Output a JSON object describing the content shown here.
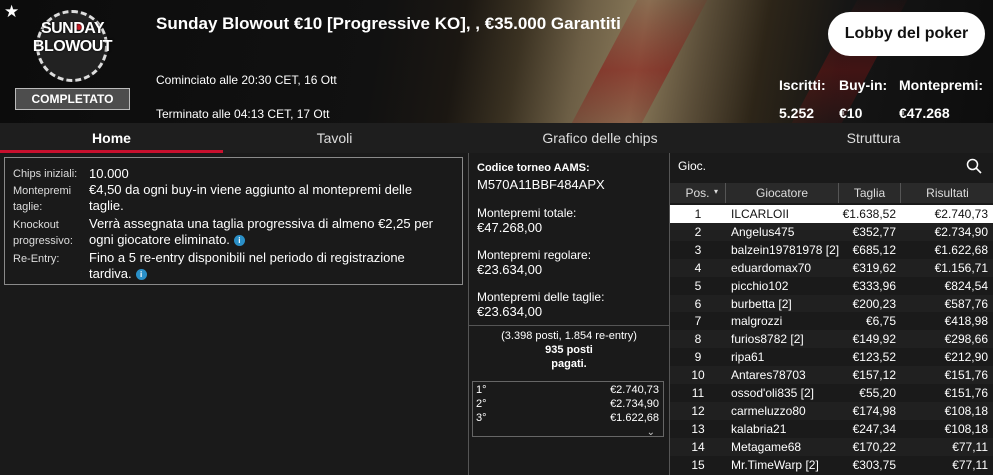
{
  "header": {
    "logo_line1": "SUNDAY",
    "logo_line2": "BLOWOUT",
    "status": "COMPLETATO",
    "title": "Sunday Blowout €10 [Progressive KO], , €35.000 Garantiti",
    "started": "Cominciato alle 20:30 CET, 16 Ott",
    "ended": "Terminato alle 04:13 CET, 17 Ott",
    "lobby_button": "Lobby del poker",
    "stats": [
      {
        "label": "Iscritti:",
        "value": "5.252"
      },
      {
        "label": "Buy-in:",
        "value": "€10"
      },
      {
        "label": "Montepremi:",
        "value": "€47.268"
      }
    ]
  },
  "tabs": [
    "Home",
    "Tavoli",
    "Grafico delle chips",
    "Struttura"
  ],
  "info": [
    {
      "label": "Chips iniziali:",
      "value": "10.000"
    },
    {
      "label": "Montepremi taglie:",
      "value": "€4,50 da ogni buy-in viene aggiunto al montepremi delle taglie."
    },
    {
      "label": "Knockout progressivo:",
      "value": "Verrà assegnata una taglia progressiva di almeno €2,25 per ogni giocatore eliminato."
    },
    {
      "label": "Re-Entry:",
      "value": "Fino a 5 re-entry disponibili nel periodo di registrazione tardiva."
    }
  ],
  "middle": {
    "aams_label": "Codice torneo AAMS:",
    "aams_value": "M570A11BBF484APX",
    "total_label": "Montepremi totale:",
    "total_value": "€47.268,00",
    "regular_label": "Montepremi regolare:",
    "regular_value": "€23.634,00",
    "bounty_label": "Montepremi delle taglie:",
    "bounty_value": "€23.634,00",
    "places_line1": "(3.398 posti, 1.854 re-entry)",
    "places_line2": "935 posti",
    "places_line3": "pagati.",
    "prizes": [
      {
        "place": "1°",
        "amount": "€2.740,73"
      },
      {
        "place": "2°",
        "amount": "€2.734,90"
      },
      {
        "place": "3°",
        "amount": "€1.622,68"
      }
    ]
  },
  "players": {
    "search_label": "Gioc.",
    "columns": [
      "Pos.",
      "Giocatore",
      "Taglia",
      "Risultati"
    ],
    "rows": [
      {
        "pos": "1",
        "name": "ILCARLOII",
        "bounty": "€1.638,52",
        "result": "€2.740,73"
      },
      {
        "pos": "2",
        "name": "Angelus475",
        "bounty": "€352,77",
        "result": "€2.734,90"
      },
      {
        "pos": "3",
        "name": "balzein19781978 [2]",
        "bounty": "€685,12",
        "result": "€1.622,68"
      },
      {
        "pos": "4",
        "name": "eduardomax70",
        "bounty": "€319,62",
        "result": "€1.156,71"
      },
      {
        "pos": "5",
        "name": "picchio102",
        "bounty": "€333,96",
        "result": "€824,54"
      },
      {
        "pos": "6",
        "name": "burbetta [2]",
        "bounty": "€200,23",
        "result": "€587,76"
      },
      {
        "pos": "7",
        "name": "malgrozzi",
        "bounty": "€6,75",
        "result": "€418,98"
      },
      {
        "pos": "8",
        "name": "furios8782 [2]",
        "bounty": "€149,92",
        "result": "€298,66"
      },
      {
        "pos": "9",
        "name": "ripa61",
        "bounty": "€123,52",
        "result": "€212,90"
      },
      {
        "pos": "10",
        "name": "Antares78703",
        "bounty": "€157,12",
        "result": "€151,76"
      },
      {
        "pos": "11",
        "name": "ossod'oli835 [2]",
        "bounty": "€55,20",
        "result": "€151,76"
      },
      {
        "pos": "12",
        "name": "carmeluzzo80",
        "bounty": "€174,98",
        "result": "€108,18"
      },
      {
        "pos": "13",
        "name": "kalabria21",
        "bounty": "€247,34",
        "result": "€108,18"
      },
      {
        "pos": "14",
        "name": "Metagame68",
        "bounty": "€170,22",
        "result": "€77,11"
      },
      {
        "pos": "15",
        "name": "Mr.TimeWarp [2]",
        "bounty": "€303,75",
        "result": "€77,11"
      }
    ]
  }
}
